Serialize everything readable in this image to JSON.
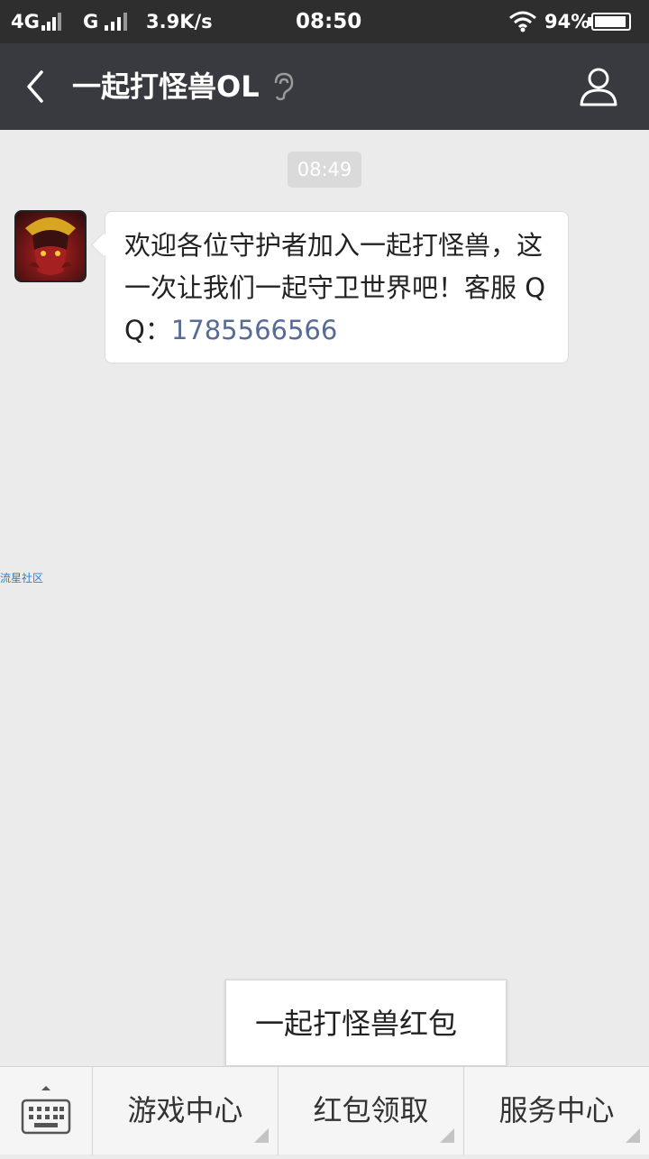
{
  "status_bar": {
    "network1": "4G",
    "network2": "G",
    "speed": "3.9K/s",
    "time": "08:50",
    "battery_percent": "94%",
    "battery_level": 0.94
  },
  "header": {
    "title": "一起打怪兽OL"
  },
  "chat": {
    "timestamp": "08:49",
    "message_text": "欢迎各位守护者加入一起打怪兽，这一次让我们一起守卫世界吧！客服 QQ：",
    "message_qq": "1785566566"
  },
  "watermark": "流星社区",
  "popup": {
    "item": "一起打怪兽红包"
  },
  "bottom_menu": {
    "items": [
      {
        "label": "游戏中心"
      },
      {
        "label": "红包领取"
      },
      {
        "label": "服务中心"
      }
    ]
  },
  "colors": {
    "status_bg": "#2e2e2e",
    "header_bg": "#393a3f",
    "chat_bg": "#ebebeb",
    "link": "#576b95"
  }
}
